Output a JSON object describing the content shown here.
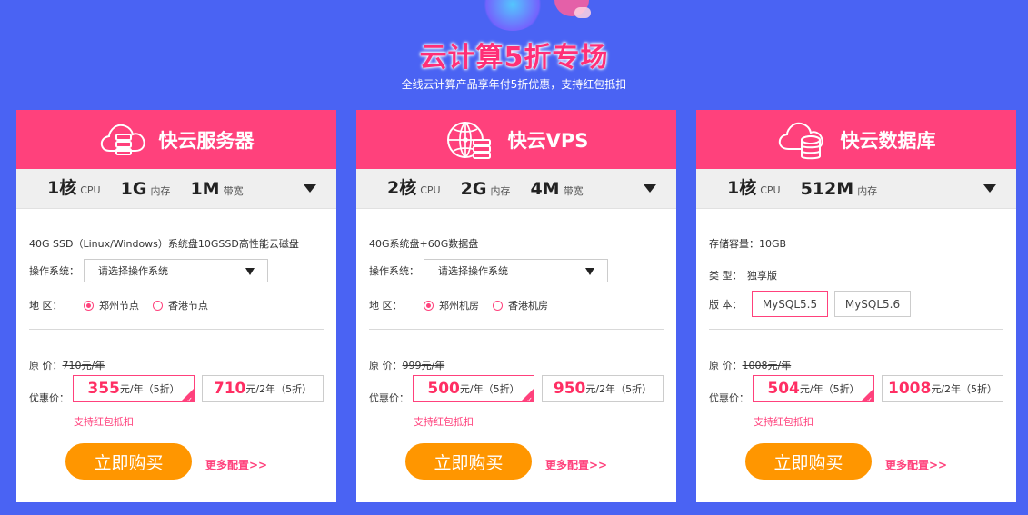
{
  "hero": {
    "title": "云计算5折专场",
    "subtitle": "全线云计算产品享年付5折优惠，支持红包抵扣"
  },
  "colors": {
    "background": "#4a63f3",
    "accent": "#ff417c",
    "button": "#ff9600"
  },
  "cards": [
    {
      "title": "快云服务器",
      "icon": "cloud-server-icon",
      "specs": [
        {
          "value": "1核",
          "unit": "CPU"
        },
        {
          "value": "1G",
          "unit": "内存"
        },
        {
          "value": "1M",
          "unit": "带宽"
        }
      ],
      "description": "40G SSD（Linux/Windows）系统盘10GSSD高性能云磁盘",
      "os_label": "操作系统：",
      "os_placeholder": "请选择操作系统",
      "region_label": "地 区：",
      "regions": [
        "郑州节点",
        "香港节点"
      ],
      "original_label": "原 价：",
      "original_price": "710元/年",
      "price_label": "优惠价：",
      "offers": [
        {
          "price": "355",
          "unit": "元/年（5折）"
        },
        {
          "price": "710",
          "unit": "元/2年（5折）"
        }
      ],
      "support": "支持红包抵扣",
      "buy": "立即购买",
      "more": "更多配置>>"
    },
    {
      "title": "快云VPS",
      "icon": "vps-globe-icon",
      "specs": [
        {
          "value": "2核",
          "unit": "CPU"
        },
        {
          "value": "2G",
          "unit": "内存"
        },
        {
          "value": "4M",
          "unit": "带宽"
        }
      ],
      "description": "40G系统盘+60G数据盘",
      "os_label": "操作系统：",
      "os_placeholder": "请选择操作系统",
      "region_label": "地 区：",
      "regions": [
        "郑州机房",
        "香港机房"
      ],
      "original_label": "原 价：",
      "original_price": "999元/年",
      "price_label": "优惠价：",
      "offers": [
        {
          "price": "500",
          "unit": "元/年（5折）"
        },
        {
          "price": "950",
          "unit": "元/2年（5折）"
        }
      ],
      "support": "支持红包抵扣",
      "buy": "立即购买",
      "more": "更多配置>>"
    },
    {
      "title": "快云数据库",
      "icon": "cloud-database-icon",
      "specs": [
        {
          "value": "1核",
          "unit": "CPU"
        },
        {
          "value": "512M",
          "unit": "内存"
        }
      ],
      "storage_label": "存储容量：",
      "storage_value": "10GB",
      "type_label": "类 型：",
      "type_value": "独享版",
      "version_label": "版 本：",
      "versions": [
        "MySQL5.5",
        "MySQL5.6"
      ],
      "original_label": "原 价：",
      "original_price": "1008元/年",
      "price_label": "优惠价：",
      "offers": [
        {
          "price": "504",
          "unit": "元/年（5折）"
        },
        {
          "price": "1008",
          "unit": "元/2年（5折）"
        }
      ],
      "support": "支持红包抵扣",
      "buy": "立即购买",
      "more": "更多配置>>"
    }
  ]
}
